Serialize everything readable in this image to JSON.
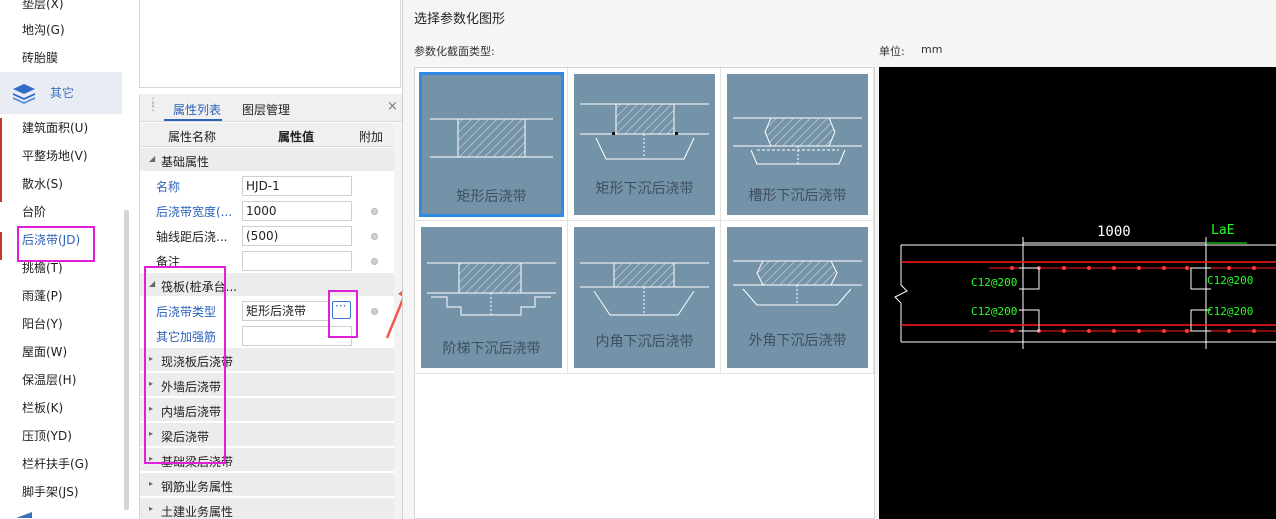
{
  "nav": {
    "items_top": [
      "垫层(X)",
      "地沟(G)",
      "砖胎膜"
    ],
    "group_label": "其它",
    "items": [
      "建筑面积(U)",
      "平整场地(V)",
      "散水(S)",
      "台阶",
      "后浇带(JD)",
      "挑檐(T)",
      "雨蓬(P)",
      "阳台(Y)",
      "屋面(W)",
      "保温层(H)",
      "栏板(K)",
      "压顶(YD)",
      "栏杆扶手(G)",
      "脚手架(JS)"
    ]
  },
  "props": {
    "tabs": [
      "属性列表",
      "图层管理"
    ],
    "close_label": "×",
    "header": {
      "name": "属性名称",
      "value": "属性值",
      "extra": "附加"
    },
    "basic_group": "基础属性",
    "rows": [
      {
        "label": "名称",
        "value": "HJD-1"
      },
      {
        "label": "后浇带宽度(...",
        "value": "1000"
      },
      {
        "label": "轴线距后浇...",
        "value": "(500)"
      },
      {
        "label": "备注",
        "value": ""
      }
    ],
    "raft_group": "筏板(桩承台...",
    "raft_rows": [
      {
        "label": "后浇带类型",
        "value": "矩形后浇带"
      },
      {
        "label": "其它加强筋",
        "value": ""
      }
    ],
    "ellipsis": "···",
    "collapsed_groups": [
      "现浇板后浇带",
      "外墙后浇带",
      "内墙后浇带",
      "梁后浇带",
      "基础梁后浇带",
      "钢筋业务属性",
      "土建业务属性"
    ]
  },
  "dialog": {
    "title": "选择参数化图形",
    "section_type_label": "参数化截面类型:",
    "unit_label": "单位:",
    "unit_value": "mm",
    "options": [
      "矩形后浇带",
      "矩形下沉后浇带",
      "槽形下沉后浇带",
      "阶梯下沉后浇带",
      "内角下沉后浇带",
      "外角下沉后浇带"
    ],
    "selected_index": 0
  },
  "preview": {
    "dimension": "1000",
    "lae_label": "LaE",
    "rebar_labels": [
      "C12@200",
      "C12@200",
      "C12@200",
      "C12@200"
    ]
  },
  "colors": {
    "accent": "#2d62b8",
    "highlight": "#e020d8",
    "thumb_bg": "#7593a8",
    "cad_green": "#22ff22",
    "cad_red": "#ff1a1a"
  }
}
